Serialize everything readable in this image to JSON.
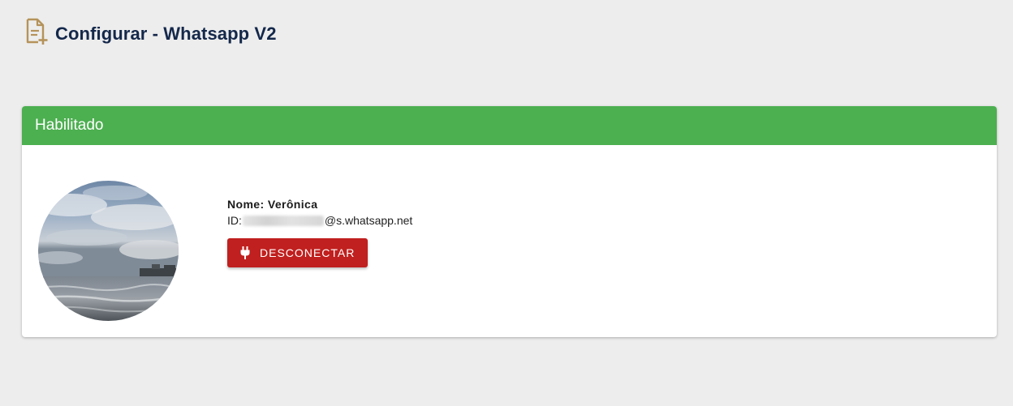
{
  "header": {
    "title": "Configurar - Whatsapp V2",
    "icon": "document-add-icon",
    "icon_color": "#b5935a"
  },
  "card": {
    "status_label": "Habilitado",
    "status_color": "#4caf50",
    "profile": {
      "name_label": "Nome:",
      "name": "Verônica",
      "id_label": "ID:",
      "id_suffix": "@s.whatsapp.net"
    },
    "disconnect_button": {
      "label": "DESCONECTAR",
      "icon": "plug-icon",
      "color": "#c0201f"
    }
  }
}
